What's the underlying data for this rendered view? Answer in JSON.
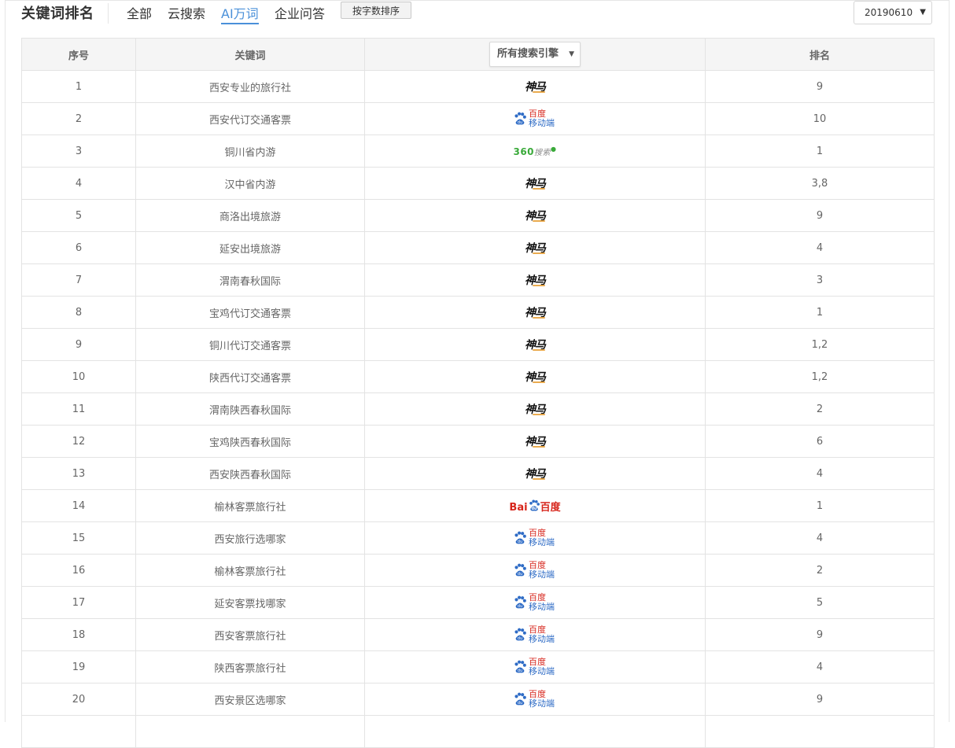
{
  "header": {
    "title": "关键词排名",
    "tabs": [
      {
        "label": "全部",
        "active": false
      },
      {
        "label": "云搜索",
        "active": false
      },
      {
        "label": "AI万词",
        "active": true
      },
      {
        "label": "企业问答",
        "active": false
      }
    ],
    "sort_button": "按字数排序",
    "date_select": "20190610"
  },
  "table": {
    "headers": {
      "index": "序号",
      "keyword": "关键词",
      "engine_filter": "所有搜索引擎",
      "rank": "排名"
    },
    "engine_labels": {
      "shenma": "神马",
      "baidu_mobile_l1": "百度",
      "baidu_mobile_l2": "移动端",
      "so360_main": "360",
      "so360_sub": "搜索",
      "baidu_pc_a": "Bai",
      "baidu_pc_b": "百度"
    },
    "rows": [
      {
        "index": "1",
        "keyword": "西安专业的旅行社",
        "engine": "shenma",
        "rank": "9"
      },
      {
        "index": "2",
        "keyword": "西安代订交通客票",
        "engine": "baidu_mobile",
        "rank": "10"
      },
      {
        "index": "3",
        "keyword": "铜川省内游",
        "engine": "so360",
        "rank": "1"
      },
      {
        "index": "4",
        "keyword": "汉中省内游",
        "engine": "shenma",
        "rank": "3,8"
      },
      {
        "index": "5",
        "keyword": "商洛出境旅游",
        "engine": "shenma",
        "rank": "9"
      },
      {
        "index": "6",
        "keyword": "延安出境旅游",
        "engine": "shenma",
        "rank": "4"
      },
      {
        "index": "7",
        "keyword": "渭南春秋国际",
        "engine": "shenma",
        "rank": "3"
      },
      {
        "index": "8",
        "keyword": "宝鸡代订交通客票",
        "engine": "shenma",
        "rank": "1"
      },
      {
        "index": "9",
        "keyword": "铜川代订交通客票",
        "engine": "shenma",
        "rank": "1,2"
      },
      {
        "index": "10",
        "keyword": "陕西代订交通客票",
        "engine": "shenma",
        "rank": "1,2"
      },
      {
        "index": "11",
        "keyword": "渭南陕西春秋国际",
        "engine": "shenma",
        "rank": "2"
      },
      {
        "index": "12",
        "keyword": "宝鸡陕西春秋国际",
        "engine": "shenma",
        "rank": "6"
      },
      {
        "index": "13",
        "keyword": "西安陕西春秋国际",
        "engine": "shenma",
        "rank": "4"
      },
      {
        "index": "14",
        "keyword": "榆林客票旅行社",
        "engine": "baidu_pc",
        "rank": "1"
      },
      {
        "index": "15",
        "keyword": "西安旅行选哪家",
        "engine": "baidu_mobile",
        "rank": "4"
      },
      {
        "index": "16",
        "keyword": "榆林客票旅行社",
        "engine": "baidu_mobile",
        "rank": "2"
      },
      {
        "index": "17",
        "keyword": "延安客票找哪家",
        "engine": "baidu_mobile",
        "rank": "5"
      },
      {
        "index": "18",
        "keyword": "西安客票旅行社",
        "engine": "baidu_mobile",
        "rank": "9"
      },
      {
        "index": "19",
        "keyword": "陕西客票旅行社",
        "engine": "baidu_mobile",
        "rank": "4"
      },
      {
        "index": "20",
        "keyword": "西安景区选哪家",
        "engine": "baidu_mobile",
        "rank": "9"
      }
    ]
  },
  "colors": {
    "accent": "#4a90d9",
    "baidu_red": "#d7261c",
    "baidu_blue": "#2f6cc6",
    "so360_green": "#3aaa3a"
  }
}
